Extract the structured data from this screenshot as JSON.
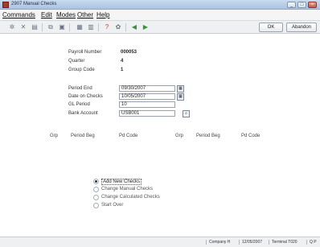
{
  "window": {
    "title": "2907  Manual Checks"
  },
  "menu": [
    {
      "label": "Commands"
    },
    {
      "label": "Edit"
    },
    {
      "label": "Modes"
    },
    {
      "label": "Other"
    },
    {
      "label": "Help"
    }
  ],
  "toolbar": {
    "icons": [
      "star-icon",
      "delete-x-icon",
      "folder-icon",
      "copy-icon",
      "paste-icon",
      "save-icon",
      "list-icon",
      "help-icon",
      "settings-icon",
      "back-icon",
      "forward-icon"
    ],
    "ok_label": "OK",
    "abandon_label": "Abandon"
  },
  "form": {
    "payroll_number_label": "Payroll Number",
    "payroll_number_value": "000053",
    "quarter_label": "Quarter",
    "quarter_value": "4",
    "group_code_label": "Group Code",
    "group_code_value": "1",
    "period_end_label": "Period End",
    "period_end_value": "09/30/2007",
    "date_on_checks_label": "Date on Checks",
    "date_on_checks_value": "10/05/2007",
    "gl_period_label": "GL Period",
    "gl_period_value": "10",
    "bank_account_label": "Bank Account",
    "bank_account_value": "USB001"
  },
  "columns": {
    "left": [
      "Grp",
      "Period Beg",
      "Pd Code"
    ],
    "right": [
      "Grp",
      "Period Beg",
      "Pd Code"
    ]
  },
  "options": [
    {
      "label": "Add New Checks",
      "selected": true
    },
    {
      "label": "Change Manual Checks",
      "selected": false
    },
    {
      "label": "Change Calculated Checks",
      "selected": false
    },
    {
      "label": "Start Over",
      "selected": false
    }
  ],
  "status": {
    "company": "Company H",
    "date": "12/05/2007",
    "terminal": "Terminal T020",
    "extra": "Q P"
  }
}
